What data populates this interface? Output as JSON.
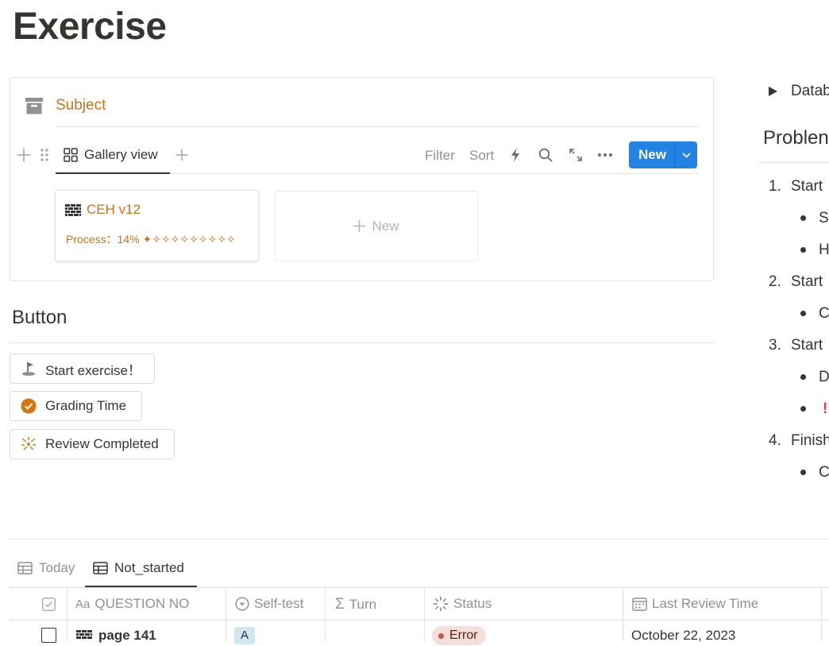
{
  "page": {
    "title": "Exercise"
  },
  "subject_db": {
    "title": "Subject",
    "view_tab": "Gallery view",
    "toolbar": {
      "filter": "Filter",
      "sort": "Sort",
      "new_label": "New"
    },
    "cards": [
      {
        "title": "CEH v12",
        "property": "Process：14% ✦✧✧✧✧✧✧✧✧✧"
      }
    ],
    "add_card_label": "New"
  },
  "button_section": {
    "heading": "Button",
    "buttons": [
      {
        "label": "Start exercise！",
        "icon": "golf-flag-icon"
      },
      {
        "label": "Grading Time",
        "icon": "check-circle-icon"
      },
      {
        "label": "Review Completed",
        "icon": "sparkle-icon"
      }
    ]
  },
  "right_panel": {
    "toggle_label": "Datab",
    "heading": "Problen",
    "list": [
      {
        "num": "1.",
        "text": "Start",
        "bullets": [
          "Sl",
          "H"
        ]
      },
      {
        "num": "2.",
        "text": "Start",
        "bullets": [
          "C"
        ]
      },
      {
        "num": "3.",
        "text": "Start",
        "bullets": [
          "D",
          "!"
        ]
      },
      {
        "num": "4.",
        "text": "Finish",
        "bullets": [
          "C"
        ]
      }
    ]
  },
  "table_db": {
    "tabs": [
      {
        "label": "Today",
        "active": false
      },
      {
        "label": "Not_started",
        "active": true
      }
    ],
    "columns": [
      {
        "label": "QUESTION NO",
        "icon": "text-icon"
      },
      {
        "label": "Self-test",
        "icon": "select-icon"
      },
      {
        "label": "Turn",
        "icon": "formula-icon"
      },
      {
        "label": "Status",
        "icon": "status-icon"
      },
      {
        "label": "Last Review Time",
        "icon": "calendar-icon"
      }
    ],
    "rows": [
      {
        "question": "page 141",
        "self_test": "A",
        "turn": "",
        "status": "Error",
        "last_review": "October 22, 2023"
      }
    ]
  },
  "colors": {
    "accent": "#2383e2",
    "brand_orange": "#c9731b",
    "status_error_bg": "#f4dfdb"
  }
}
